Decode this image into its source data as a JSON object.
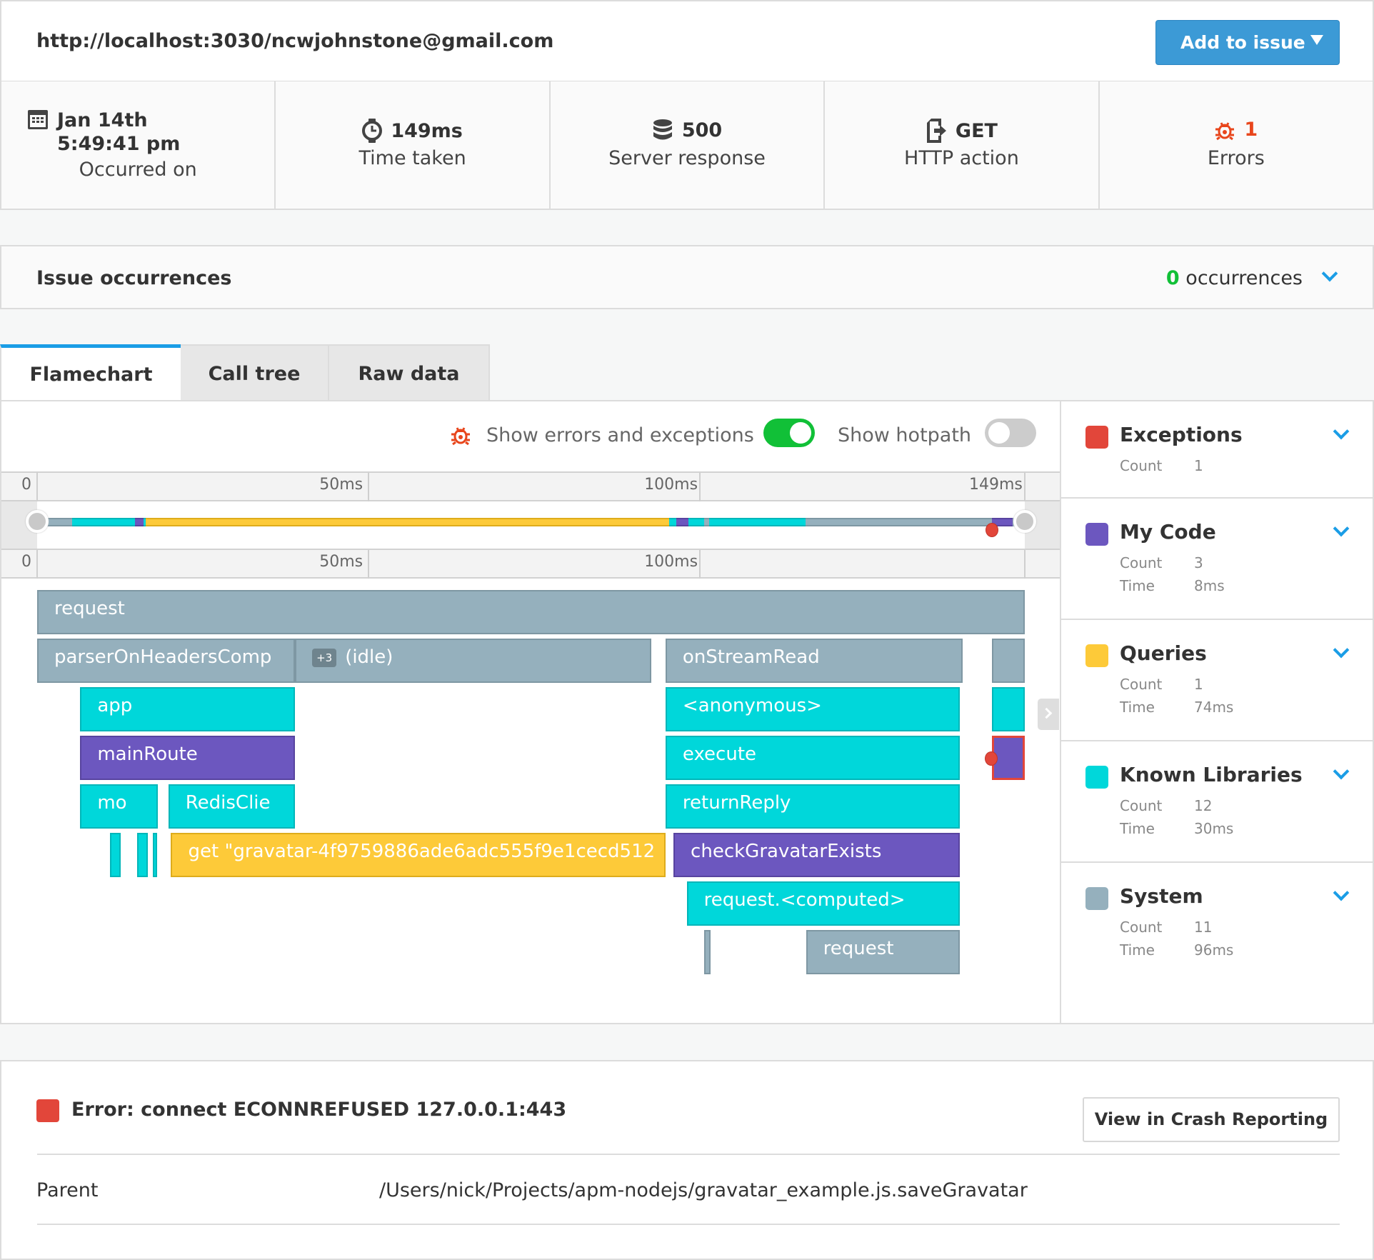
{
  "header": {
    "url": "http://localhost:3030/ncwjohnstone@gmail.com",
    "add_to_issue_label": "Add to issue"
  },
  "stats": [
    {
      "icon": "calendar-icon",
      "value": "Jan 14th 5:49:41 pm",
      "caption": "Occurred on"
    },
    {
      "icon": "stopwatch-icon",
      "value": "149ms",
      "caption": "Time taken"
    },
    {
      "icon": "database-icon",
      "value": "500",
      "caption": "Server response"
    },
    {
      "icon": "http-action-icon",
      "value": "GET",
      "caption": "HTTP action"
    },
    {
      "icon": "bug-icon",
      "value": "1",
      "caption": "Errors"
    }
  ],
  "occurrences": {
    "title": "Issue occurrences",
    "count": "0",
    "count_label": "occurrences"
  },
  "tabs": [
    {
      "label": "Flamechart",
      "active": true
    },
    {
      "label": "Call tree",
      "active": false
    },
    {
      "label": "Raw data",
      "active": false
    }
  ],
  "toolbar": {
    "show_errors_label": "Show errors and exceptions",
    "show_errors_on": true,
    "show_hotpath_label": "Show hotpath",
    "show_hotpath_on": false
  },
  "timeline": {
    "total_ms": 149,
    "top_ticks": [
      "0",
      "50ms",
      "100ms",
      "149ms"
    ],
    "bottom_ticks": [
      "0",
      "50ms",
      "100ms"
    ],
    "overview_segments": [
      {
        "start": 0,
        "end": 5.3,
        "kind": "sys"
      },
      {
        "start": 5.3,
        "end": 14.8,
        "kind": "lib"
      },
      {
        "start": 14.8,
        "end": 16.1,
        "kind": "my"
      },
      {
        "start": 16.1,
        "end": 16.4,
        "kind": "lib"
      },
      {
        "start": 16.4,
        "end": 95.3,
        "kind": "qry"
      },
      {
        "start": 95.3,
        "end": 96.4,
        "kind": "lib"
      },
      {
        "start": 96.4,
        "end": 98.3,
        "kind": "my"
      },
      {
        "start": 98.3,
        "end": 100.6,
        "kind": "lib"
      },
      {
        "start": 100.6,
        "end": 101.4,
        "kind": "sys"
      },
      {
        "start": 101.4,
        "end": 115.9,
        "kind": "lib"
      },
      {
        "start": 115.9,
        "end": 144,
        "kind": "sys"
      },
      {
        "start": 144,
        "end": 147.2,
        "kind": "my"
      }
    ],
    "error_at_ms": 144
  },
  "flamechart": {
    "frames": [
      {
        "label": "request",
        "start": 0,
        "end": 149,
        "depth": 0,
        "kind": "sys"
      },
      {
        "label": "parserOnHeadersComp",
        "start": 0,
        "end": 38.9,
        "depth": 1,
        "kind": "sys"
      },
      {
        "label": "(idle)",
        "badge": "+3",
        "start": 38.9,
        "end": 92.7,
        "depth": 1,
        "kind": "sys"
      },
      {
        "label": "onStreamRead",
        "start": 94.8,
        "end": 139.6,
        "depth": 1,
        "kind": "sys"
      },
      {
        "label": "",
        "start": 144,
        "end": 149,
        "depth": 1,
        "kind": "sys"
      },
      {
        "label": "app",
        "start": 6.5,
        "end": 38.9,
        "depth": 2,
        "kind": "lib"
      },
      {
        "label": "<anonymous>",
        "start": 94.8,
        "end": 139.2,
        "depth": 2,
        "kind": "lib"
      },
      {
        "label": "",
        "start": 144,
        "end": 149,
        "depth": 2,
        "kind": "lib"
      },
      {
        "label": "mainRoute",
        "start": 6.5,
        "end": 38.9,
        "depth": 3,
        "kind": "my"
      },
      {
        "label": "execute",
        "start": 94.8,
        "end": 139.2,
        "depth": 3,
        "kind": "lib"
      },
      {
        "label": "",
        "start": 144,
        "end": 149,
        "depth": 3,
        "kind": "my",
        "error": true
      },
      {
        "label": "mo",
        "start": 6.5,
        "end": 18.2,
        "depth": 4,
        "kind": "lib"
      },
      {
        "label": "RedisClie",
        "start": 19.8,
        "end": 38.9,
        "depth": 4,
        "kind": "lib"
      },
      {
        "label": "returnReply",
        "start": 94.8,
        "end": 139.2,
        "depth": 4,
        "kind": "lib"
      },
      {
        "label": "",
        "start": 11,
        "end": 12.6,
        "depth": 5,
        "kind": "lib"
      },
      {
        "label": "",
        "start": 15.1,
        "end": 16.7,
        "depth": 5,
        "kind": "lib"
      },
      {
        "label": "",
        "start": 17.4,
        "end": 18.1,
        "depth": 5,
        "kind": "lib"
      },
      {
        "label": "get \"gravatar-4f9759886ade6adc555f9e1cecd512",
        "start": 20.2,
        "end": 94.8,
        "depth": 5,
        "kind": "qry"
      },
      {
        "label": "checkGravatarExists",
        "start": 96,
        "end": 139.2,
        "depth": 5,
        "kind": "my"
      },
      {
        "label": "request.<computed>",
        "start": 98,
        "end": 139.2,
        "depth": 6,
        "kind": "lib"
      },
      {
        "label": "",
        "start": 100.6,
        "end": 101.6,
        "depth": 7,
        "kind": "sys"
      },
      {
        "label": "request",
        "start": 116,
        "end": 139.2,
        "depth": 7,
        "kind": "sys"
      }
    ]
  },
  "legend": [
    {
      "name": "Exceptions",
      "color": "#e2463a",
      "count": "1",
      "time": null
    },
    {
      "name": "My Code",
      "color": "#6c57bf",
      "count": "3",
      "time": "8ms"
    },
    {
      "name": "Queries",
      "color": "#fdca39",
      "count": "1",
      "time": "74ms"
    },
    {
      "name": "Known Libraries",
      "color": "#00d7da",
      "count": "12",
      "time": "30ms"
    },
    {
      "name": "System",
      "color": "#95b0bd",
      "count": "11",
      "time": "96ms"
    }
  ],
  "legend_labels": {
    "count": "Count",
    "time": "Time"
  },
  "error": {
    "message": "Error: connect ECONNREFUSED 127.0.0.1:443",
    "view_button_label": "View in Crash Reporting",
    "parent_label": "Parent",
    "parent_value": "/Users/nick/Projects/apm-nodejs/gravatar_example.js.saveGravatar"
  },
  "colors": {
    "accent": "#1a9de6",
    "primary_button": "#3c9ad6",
    "error": "#e8461c",
    "toggle_on": "#11c037",
    "toggle_off": "#cccccc"
  }
}
